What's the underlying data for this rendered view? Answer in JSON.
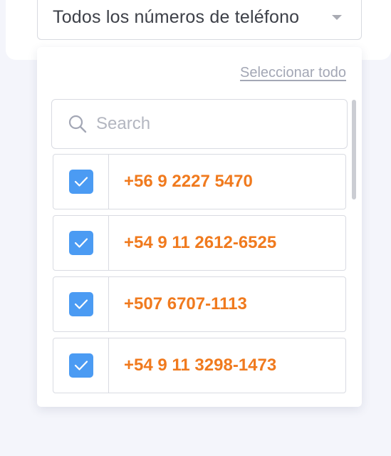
{
  "filter": {
    "selected_label": "Todos los números de teléfono"
  },
  "dropdown": {
    "select_all_label": "Seleccionar todo",
    "search_placeholder": "Search",
    "items": [
      {
        "phone": "+56 9 2227 5470",
        "checked": true
      },
      {
        "phone": "+54 9 11 2612-6525",
        "checked": true
      },
      {
        "phone": "+507 6707-1113",
        "checked": true
      },
      {
        "phone": "+54 9 11 3298-1473",
        "checked": true
      }
    ]
  },
  "colors": {
    "checkbox": "#4b9bf3",
    "phone_text": "#f07a1e",
    "link": "#a3a7b5"
  },
  "icons": {
    "search": "search-icon",
    "caret": "caret-down-icon",
    "check": "checkmark-icon"
  }
}
